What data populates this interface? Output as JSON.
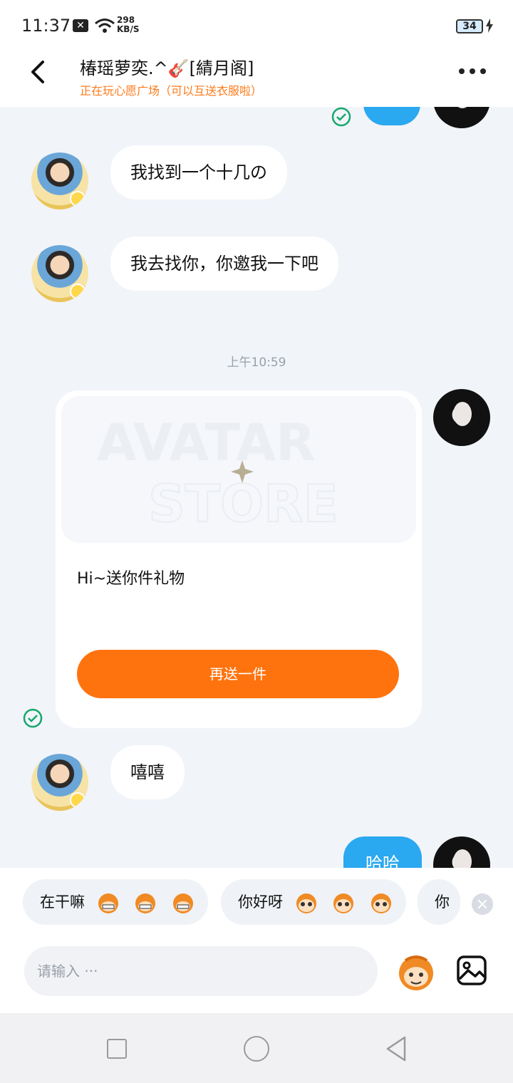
{
  "status_bar": {
    "time": "11:37",
    "notif_badge": "✕",
    "net_speed_value": "298",
    "net_speed_unit": "KB/S",
    "battery": "34"
  },
  "header": {
    "title": "椿瑶萝奕.^🎸[綪月阁]",
    "subtitle": "正在玩心愿广场（可以互送衣服啦）"
  },
  "messages": {
    "msg1": "我找到一个十几の",
    "msg2": "我去找你，你邀我一下吧",
    "timestamp": "上午10:59",
    "gift_text": "Hi~送你件礼物",
    "gift_button": "再送一件",
    "msg3": "嘻嘻",
    "msg4_partial": "哈哈",
    "banner_line1": "AVATAR",
    "banner_line2": "STORE"
  },
  "quick_replies": [
    {
      "label": "在干嘛"
    },
    {
      "label": "你好呀"
    },
    {
      "label": "你"
    }
  ],
  "composer": {
    "placeholder": "请输入 ···"
  },
  "colors": {
    "accent": "#ff730f",
    "bubble_out": "#2aa8f0",
    "check_green": "#15a86b"
  },
  "icons": [
    "back-icon",
    "more-icon",
    "check-icon",
    "monkey-emoji-icon",
    "image-icon",
    "close-icon"
  ]
}
